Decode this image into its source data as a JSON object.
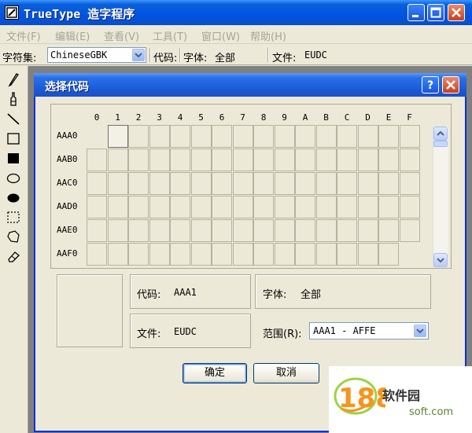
{
  "window": {
    "title": "TrueType 造字程序"
  },
  "menu": [
    "文件(F)",
    "编辑(E)",
    "查看(V)",
    "工具(T)",
    "窗口(W)",
    "帮助(H)"
  ],
  "infobar": {
    "charset_label": "字符集:",
    "charset_value": "ChineseGBK",
    "code_label": "代码:",
    "font_label": "字体:",
    "font_value": "全部",
    "file_label": "文件:",
    "file_value": "EUDC"
  },
  "tools": [
    "pencil-icon",
    "brush-icon",
    "line-icon",
    "hollow-rect-icon",
    "filled-rect-icon",
    "hollow-ellipse-icon",
    "filled-ellipse-icon",
    "rect-select-icon",
    "freeform-select-icon",
    "eraser-icon"
  ],
  "dialog": {
    "title": "选择代码",
    "columns": [
      "0",
      "1",
      "2",
      "3",
      "4",
      "5",
      "6",
      "7",
      "8",
      "9",
      "A",
      "B",
      "C",
      "D",
      "E",
      "F"
    ],
    "rows": [
      "AAA0",
      "AAB0",
      "AAC0",
      "AAD0",
      "AAE0",
      "AAF0"
    ],
    "selected_cell": "AAA1",
    "code_label": "代码:",
    "code_value": "AAA1",
    "font_label": "字体:",
    "font_value": "全部",
    "file_label": "文件:",
    "file_value": "EUDC",
    "range_label": "范围(R):",
    "range_value": "AAA1 - AFFE",
    "ok_label": "确定",
    "cancel_label": "取消"
  },
  "watermark": {
    "brand": "软件园",
    "url": "soft.com",
    "number": "188"
  },
  "colors": {
    "title_blue": "#0054e3",
    "close_red": "#c7401e",
    "dialog_bg": "#ece9d8",
    "canvas_gray": "#808080"
  }
}
